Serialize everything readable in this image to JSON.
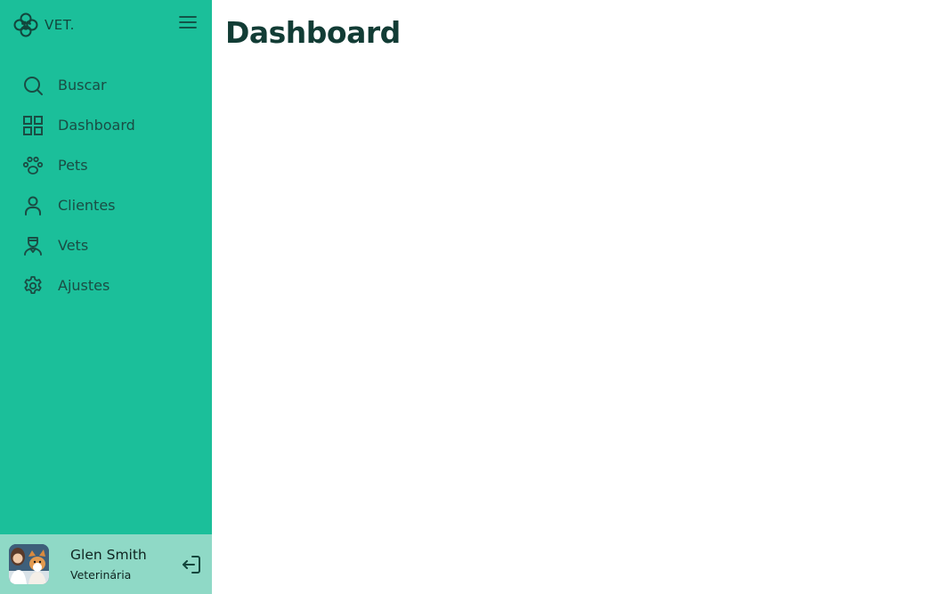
{
  "brand": {
    "name": "VET.",
    "icon": "paw-clover-logo-icon"
  },
  "header": {
    "menu_icon": "hamburger-menu-icon"
  },
  "sidebar": {
    "items": [
      {
        "label": "Buscar",
        "icon": "search-icon"
      },
      {
        "label": "Dashboard",
        "icon": "grid-icon"
      },
      {
        "label": "Pets",
        "icon": "paw-icon"
      },
      {
        "label": "Clientes",
        "icon": "user-icon"
      },
      {
        "label": "Vets",
        "icon": "vet-doctor-icon"
      },
      {
        "label": "Ajustes",
        "icon": "gear-icon"
      }
    ]
  },
  "user": {
    "name": "Glen Smith",
    "role": "Veterinária",
    "avatar": "avatar-photo",
    "logout_icon": "logout-icon"
  },
  "main": {
    "title": "Dashboard"
  },
  "colors": {
    "sidebar_bg": "#1bbf9a",
    "user_panel_bg": "#8fd9c6",
    "text_dark": "#1a4d44",
    "title": "#123c35"
  }
}
